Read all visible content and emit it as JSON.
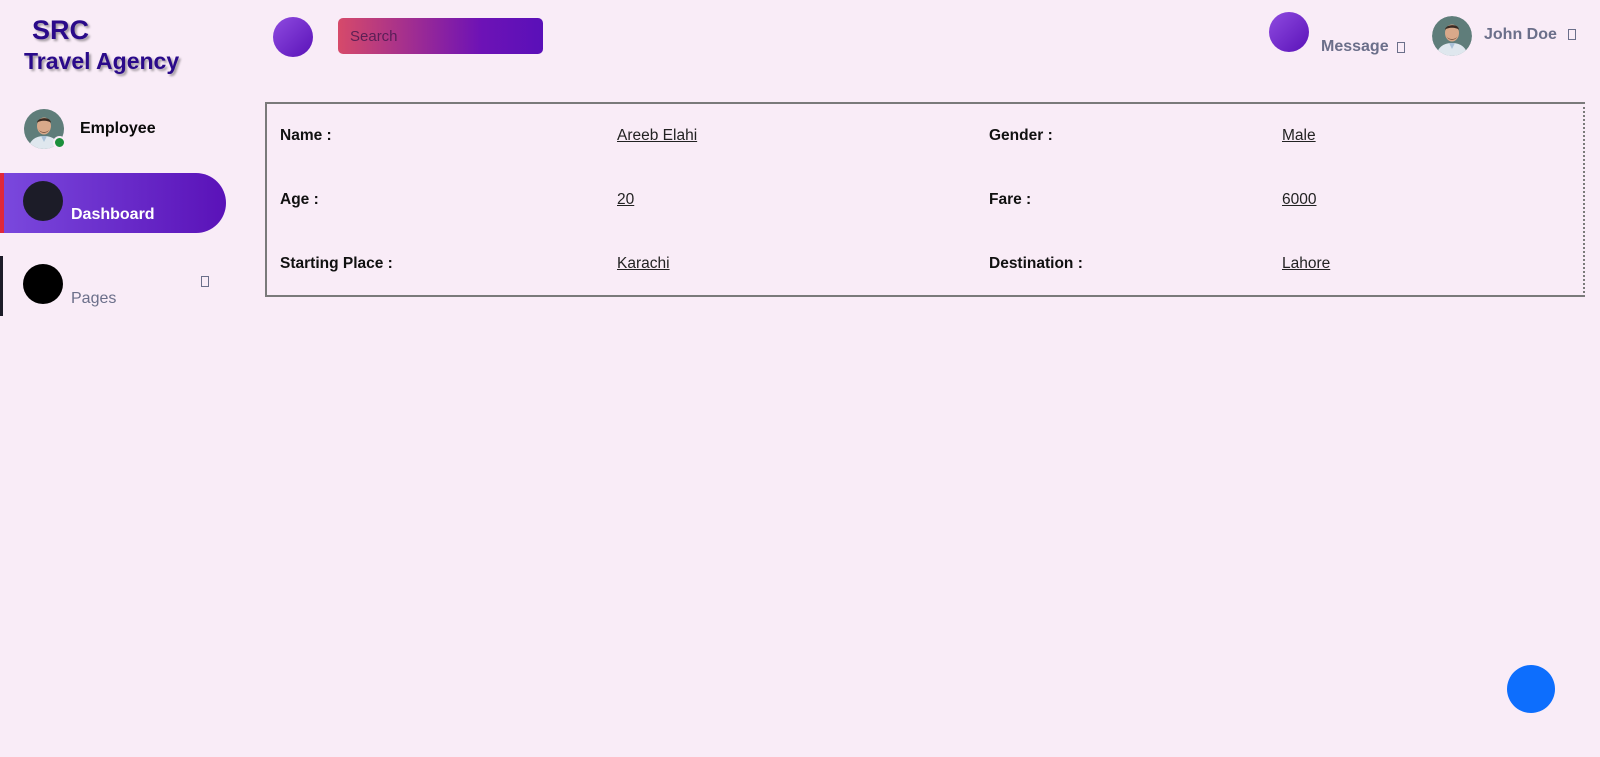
{
  "brand": {
    "line1": "SRC",
    "line2": "Travel Agency"
  },
  "profile": {
    "role": "Employee",
    "status": "online"
  },
  "sidebar": {
    "items": [
      {
        "label": "Dashboard",
        "active": true
      },
      {
        "label": "Pages",
        "active": false,
        "icon": "chevron-icon"
      }
    ]
  },
  "topbar": {
    "search_placeholder": "Search",
    "message_label": "Message",
    "user_name": "John Doe"
  },
  "details": {
    "rows": [
      {
        "label_left": "Name :",
        "value_left": "Areeb Elahi",
        "label_right": "Gender :",
        "value_right": "Male"
      },
      {
        "label_left": "Age :",
        "value_left": "20",
        "label_right": "Fare :",
        "value_right": "6000"
      },
      {
        "label_left": "Starting Place :",
        "value_left": "Karachi",
        "label_right": "Destination :",
        "value_right": "Lahore"
      }
    ]
  },
  "colors": {
    "background": "#f9ecf7",
    "brand_text": "#2a0a8a",
    "accent_gradient_start": "#7a48dd",
    "accent_gradient_end": "#5a12b8",
    "active_indicator": "#e0283a",
    "fab": "#0d6efd",
    "online": "#1b8f3b"
  }
}
